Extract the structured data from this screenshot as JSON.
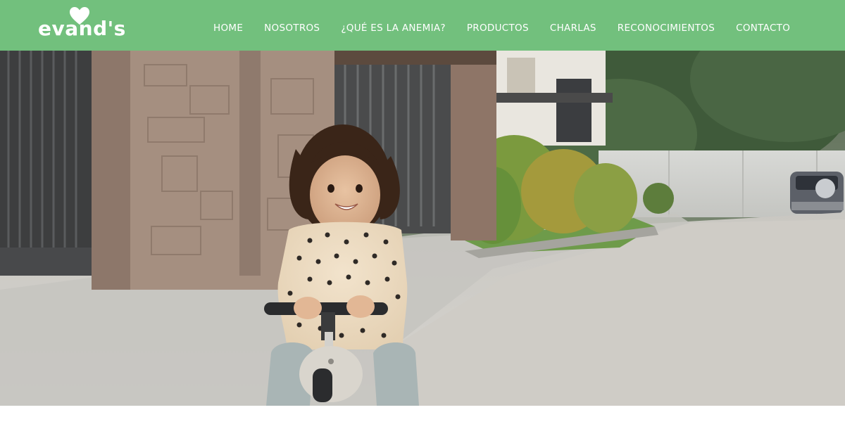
{
  "brand": {
    "logo_text": "evand's",
    "logo_icon": "heart-icon",
    "bar_color": "#72c07d"
  },
  "nav": {
    "items": [
      {
        "label": "HOME"
      },
      {
        "label": "NOSOTROS"
      },
      {
        "label": "¿QUÉ ES LA ANEMIA?"
      },
      {
        "label": "PRODUCTOS"
      },
      {
        "label": "CHARLAS"
      },
      {
        "label": "RECONOCIMIENTOS"
      },
      {
        "label": "CONTACTO"
      }
    ]
  },
  "hero": {
    "image": "toddler-on-balance-bike-photo"
  }
}
